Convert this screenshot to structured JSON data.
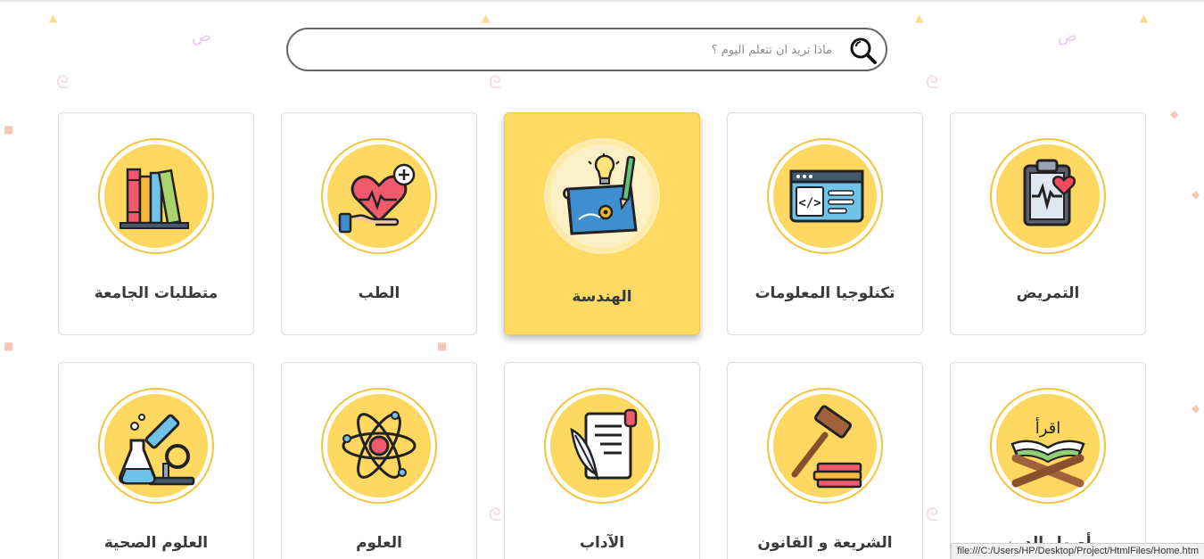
{
  "search": {
    "placeholder": "ماذا تريد ان تتعلم اليوم ؟",
    "icon": "magnifier-icon"
  },
  "colors": {
    "accent": "#ffd861",
    "active_card": "#ffda63",
    "ring": "#f3c33e",
    "text": "#3a3a3a"
  },
  "categories": [
    {
      "label": "التمريض",
      "icon": "clipboard-heart-icon"
    },
    {
      "label": "تكنلوجيا المعلومات",
      "icon": "code-window-icon"
    },
    {
      "label": "الهندسة",
      "icon": "blueprint-icon",
      "active": true
    },
    {
      "label": "الطب",
      "icon": "heart-hand-icon"
    },
    {
      "label": "متطلبات الجامعة",
      "icon": "books-icon"
    },
    {
      "label": "أصول الدين",
      "icon": "quran-stand-icon"
    },
    {
      "label": "الشريعة و القانون",
      "icon": "gavel-icon"
    },
    {
      "label": "الآداب",
      "icon": "scroll-quill-icon"
    },
    {
      "label": "العلوم",
      "icon": "atom-icon"
    },
    {
      "label": "العلوم الصحية",
      "icon": "microscope-icon"
    }
  ],
  "quran_text": "اقرأ",
  "status_url": "file:///C:/Users/HP/Desktop/Project/HtmlFiles/Home.htm"
}
